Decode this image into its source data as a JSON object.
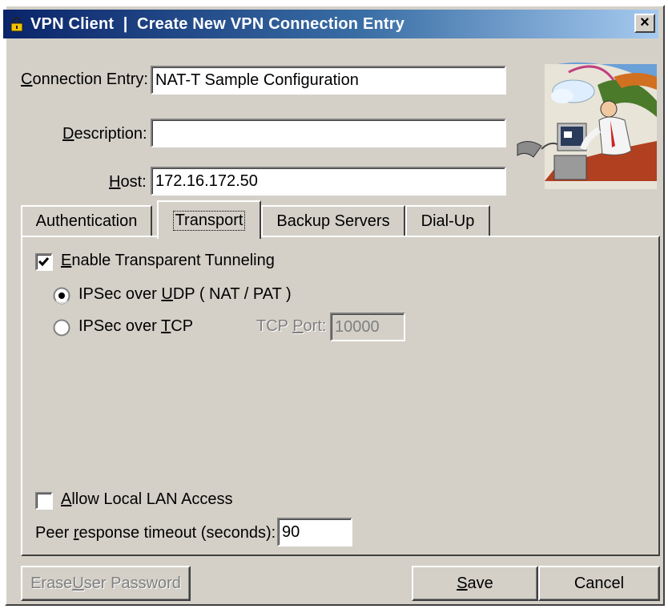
{
  "window": {
    "title": "VPN Client  |  Create New VPN Connection Entry",
    "close_glyph": "×"
  },
  "form": {
    "connection_entry": {
      "label_ul": "C",
      "label_rest": "onnection Entry:",
      "value": "NAT-T Sample Configuration"
    },
    "description": {
      "label_ul": "D",
      "label_rest": "escription:",
      "value": ""
    },
    "host": {
      "label_ul": "H",
      "label_rest": "ost:",
      "value": "172.16.172.50"
    }
  },
  "tabs": [
    {
      "label": "Authentication",
      "active": false
    },
    {
      "label": "Transport",
      "active": true
    },
    {
      "label": "Backup Servers",
      "active": false
    },
    {
      "label": "Dial-Up",
      "active": false
    }
  ],
  "transport": {
    "enable_tunneling": {
      "label_ul": "E",
      "label_rest": "nable Transparent Tunneling",
      "checked": true
    },
    "ipsec_udp": {
      "label_pre": "IPSec over ",
      "label_ul": "U",
      "label_rest": "DP ( NAT / PAT )",
      "selected": true
    },
    "ipsec_tcp": {
      "label_pre": "IPSec over ",
      "label_ul": "T",
      "label_rest": "CP",
      "selected": false
    },
    "tcp_port": {
      "label_pre": "TCP ",
      "label_ul": "P",
      "label_rest": "ort:",
      "value": "10000"
    },
    "allow_local_lan": {
      "label_ul": "A",
      "label_rest": "llow Local LAN Access",
      "checked": false
    },
    "peer_timeout": {
      "label_pre": "Peer ",
      "label_ul": "r",
      "label_rest": "esponse timeout (seconds):",
      "value": "90"
    }
  },
  "buttons": {
    "erase": {
      "label_pre": "Erase ",
      "label_ul": "U",
      "label_rest": "ser Password"
    },
    "save": {
      "label_ul": "S",
      "label_rest": "ave"
    },
    "cancel": {
      "label": "Cancel"
    }
  },
  "icons": {
    "app": "padlock-icon",
    "illustration": "vpn-user-illustration"
  },
  "colors": {
    "titlebar_start": "#0a246a",
    "titlebar_end": "#a6caf0",
    "face": "#d4d0c8"
  }
}
